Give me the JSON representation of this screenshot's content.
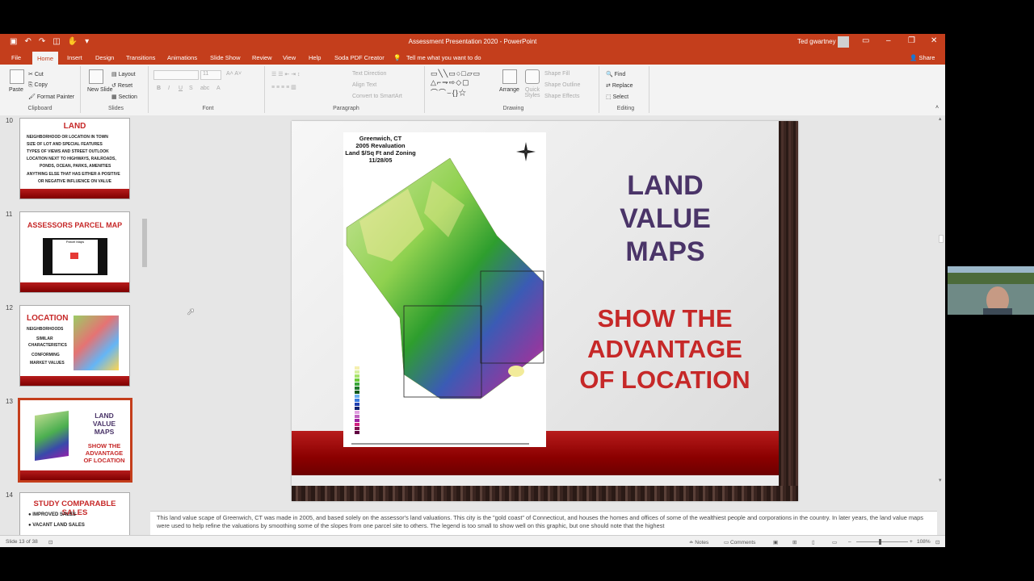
{
  "window": {
    "title": "Assessment Presentation 2020 - PowerPoint",
    "user": "Ted gwartney"
  },
  "tabs": [
    "File",
    "Home",
    "Insert",
    "Design",
    "Transitions",
    "Animations",
    "Slide Show",
    "Review",
    "View",
    "Help",
    "Soda PDF Creator",
    "Tell me what you want to do"
  ],
  "active_tab": "Home",
  "share_label": "Share",
  "ribbon": {
    "clipboard": {
      "paste": "Paste",
      "cut": "Cut",
      "copy": "Copy",
      "format_painter": "Format Painter",
      "label": "Clipboard"
    },
    "slides": {
      "new_slide": "New Slide",
      "layout": "Layout",
      "reset": "Reset",
      "section": "Section",
      "label": "Slides"
    },
    "font": {
      "size": "11",
      "label": "Font"
    },
    "paragraph": {
      "text_direction": "Text Direction",
      "align_text": "Align Text",
      "smartart": "Convert to SmartArt",
      "label": "Paragraph"
    },
    "drawing": {
      "arrange": "Arrange",
      "quick_styles": "Quick Styles",
      "shape_fill": "Shape Fill",
      "shape_outline": "Shape Outline",
      "shape_effects": "Shape Effects",
      "label": "Drawing"
    },
    "editing": {
      "find": "Find",
      "replace": "Replace",
      "select": "Select",
      "label": "Editing"
    }
  },
  "thumbnails": [
    {
      "number": "10",
      "title": "LAND",
      "lines": [
        "NEIGHBORHOOD OR LOCATION IN TOWN",
        "SIZE OF LOT AND SPECIAL FEATURES",
        "TYPES OF VIEWS AND STREET OUTLOOK",
        "LOCATION NEXT TO HIGHWAYS, RAILROADS,",
        "PONDS, OCEAN, PARKS, AMENITIES",
        "ANYTHING ELSE THAT HAS EITHER A POSITIVE",
        "OR NEGATIVE INFLUENCE ON VALUE"
      ]
    },
    {
      "number": "11",
      "title": "ASSESSORS PARCEL MAP",
      "caption": "Parcel Maps"
    },
    {
      "number": "12",
      "title": "LOCATION",
      "lines": [
        "NEIGHBORHOODS",
        "SIMILAR",
        "CHARACTERISTICS",
        "CONFORMING",
        "MARKET VALUES"
      ]
    },
    {
      "number": "13",
      "lines": [
        "LAND",
        "VALUE",
        "MAPS",
        "SHOW THE",
        "ADVANTAGE",
        "OF LOCATION"
      ]
    },
    {
      "number": "14",
      "title": "STUDY COMPARABLE SALES",
      "lines": [
        "IMPROVED SALES",
        "VACANT LAND SALES"
      ]
    }
  ],
  "slide": {
    "map_title": [
      "Greenwich, CT",
      "2005 Revaluation",
      "Land $/Sq Ft and Zoning",
      "11/28/05"
    ],
    "heading": [
      "LAND",
      "VALUE",
      "MAPS"
    ],
    "subheading": [
      "SHOW THE",
      "ADVANTAGE",
      "OF LOCATION"
    ]
  },
  "notes": "This land value scape of Greenwich, CT was made in 2005, and based solely on the assessor's land valuations. This city is the \"gold coast\" of Connecticut, and houses the homes and offices of some of the wealthiest people and corporations in the country. In later years, the land value maps were used to help refine the valuations by smoothing some of the slopes from one parcel site to others. The legend is too small to show well on this graphic, but one should note that the highest",
  "status": {
    "slide_of": "Slide 13 of 38",
    "notes": "Notes",
    "comments": "Comments",
    "zoom": "108%"
  },
  "colors": {
    "brand": "#c43e1c",
    "slide_red": "#c62828",
    "slide_purple": "#4a3468"
  }
}
